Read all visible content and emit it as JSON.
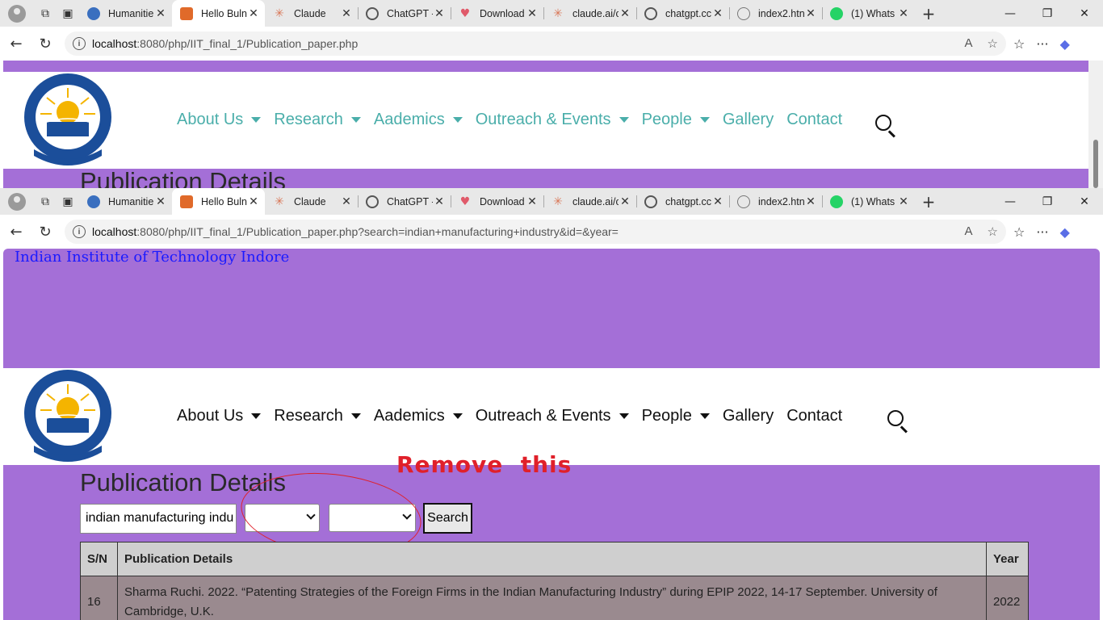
{
  "browser": {
    "tabs": [
      {
        "title": "Humanitie",
        "favicon_color": "#3a6fbf"
      },
      {
        "title": "Hello Buln",
        "favicon_color": "#e06a2a",
        "active": true
      },
      {
        "title": "Claude",
        "favicon_color": "#d97757"
      },
      {
        "title": "ChatGPT -",
        "favicon_color": "#555555"
      },
      {
        "title": "Download",
        "favicon_color": "#e05a6a"
      },
      {
        "title": "claude.ai/c",
        "favicon_color": "#d97757"
      },
      {
        "title": "chatgpt.cc",
        "favicon_color": "#555555"
      },
      {
        "title": "index2.htn",
        "favicon_color": "#777777"
      },
      {
        "title": "(1) Whats",
        "favicon_color": "#25d366"
      }
    ],
    "url_top": {
      "host": "localhost",
      "path": ":8080/php/IIT_final_1/Publication_paper.php"
    },
    "url_bottom": {
      "host": "localhost",
      "path": ":8080/php/IIT_final_1/Publication_paper.php?search=indian+manufacturing+industry&id=&year="
    }
  },
  "site": {
    "header_title": "Indian Institute of Technology Indore",
    "menu": [
      "About Us",
      "Research",
      "Aademics",
      "Outreach & Events",
      "People",
      "Gallery",
      "Contact"
    ],
    "menu_color_top": "#4aaeaa",
    "menu_color_bottom": "#111111",
    "accent": "#a46fd7"
  },
  "page": {
    "title": "Publication Details",
    "search_value": "indian manufacturing indu",
    "search_button": "Search",
    "annotation": "Remove  this",
    "table": {
      "headers": [
        "S/N",
        "Publication Details",
        "Year"
      ],
      "rows": [
        [
          "16",
          "Sharma Ruchi. 2022. “Patenting Strategies of the Foreign Firms in the Indian Manufacturing Industry” during EPIP 2022, 14-17 September. University of Cambridge, U.K.",
          "2022"
        ]
      ]
    }
  }
}
